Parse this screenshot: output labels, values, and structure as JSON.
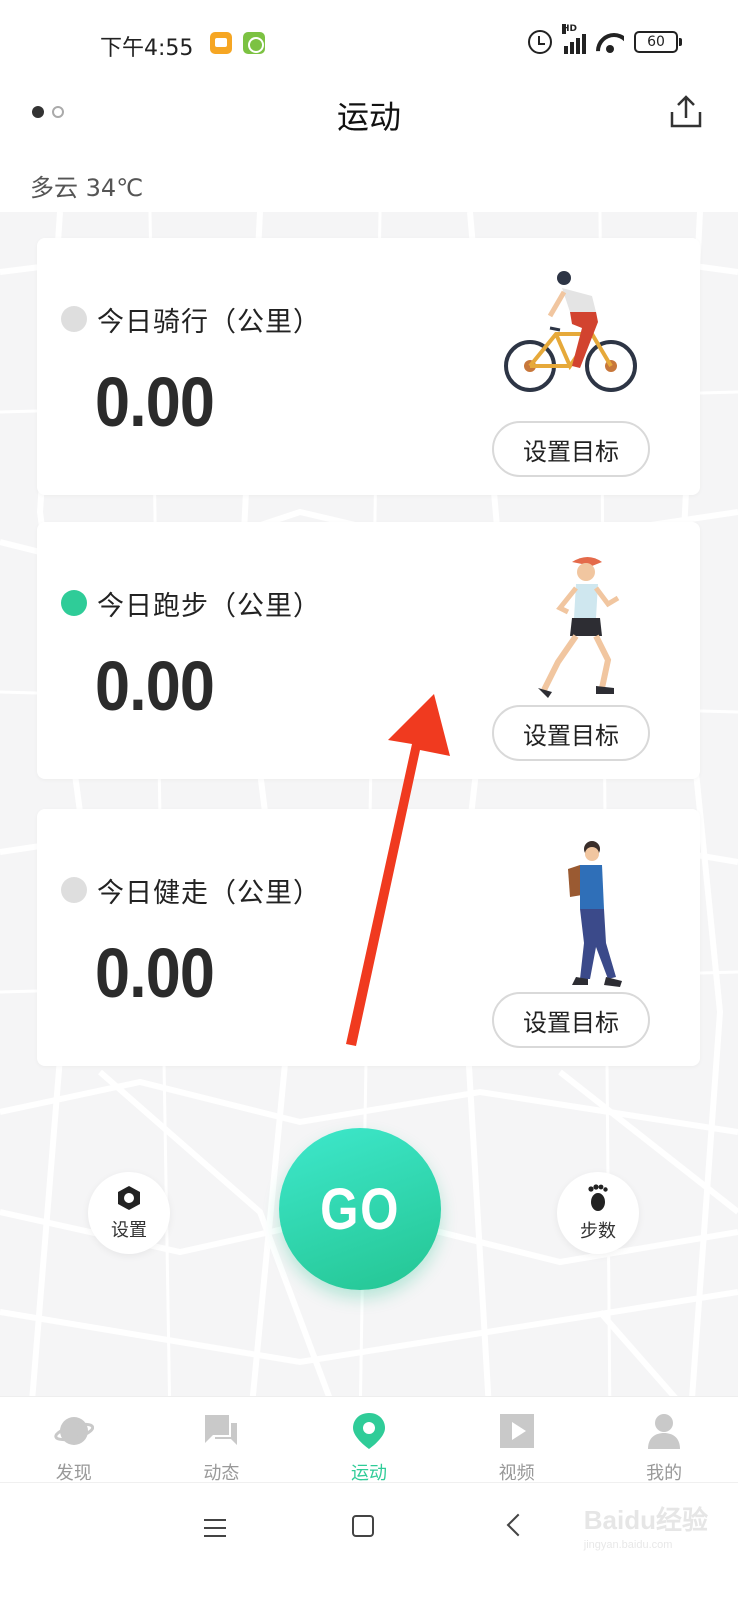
{
  "status_bar": {
    "time": "下午4:55",
    "network_label": "HD",
    "battery": "60"
  },
  "header": {
    "title": "运动",
    "weather": "多云 34℃"
  },
  "cards": [
    {
      "label": "今日骑行（公里）",
      "value": "0.00",
      "goal_button": "设置目标",
      "active": false,
      "icon": "cyclist-illustration"
    },
    {
      "label": "今日跑步（公里）",
      "value": "0.00",
      "goal_button": "设置目标",
      "active": true,
      "icon": "runner-illustration"
    },
    {
      "label": "今日健走（公里）",
      "value": "0.00",
      "goal_button": "设置目标",
      "active": false,
      "icon": "walker-illustration"
    }
  ],
  "controls": {
    "settings_label": "设置",
    "go_label": "GO",
    "steps_label": "步数"
  },
  "tabs": [
    {
      "label": "发现",
      "icon": "planet-icon",
      "active": false
    },
    {
      "label": "动态",
      "icon": "chat-icon",
      "active": false
    },
    {
      "label": "运动",
      "icon": "location-pin-icon",
      "active": true
    },
    {
      "label": "视频",
      "icon": "play-icon",
      "active": false
    },
    {
      "label": "我的",
      "icon": "person-icon",
      "active": false
    }
  ],
  "watermark": {
    "text": "Baidu经验",
    "subtext": "jingyan.baidu.com"
  },
  "colors": {
    "accent": "#2fcc98",
    "inactive_dot": "#dedede",
    "annotation_arrow": "#f03a1f"
  }
}
